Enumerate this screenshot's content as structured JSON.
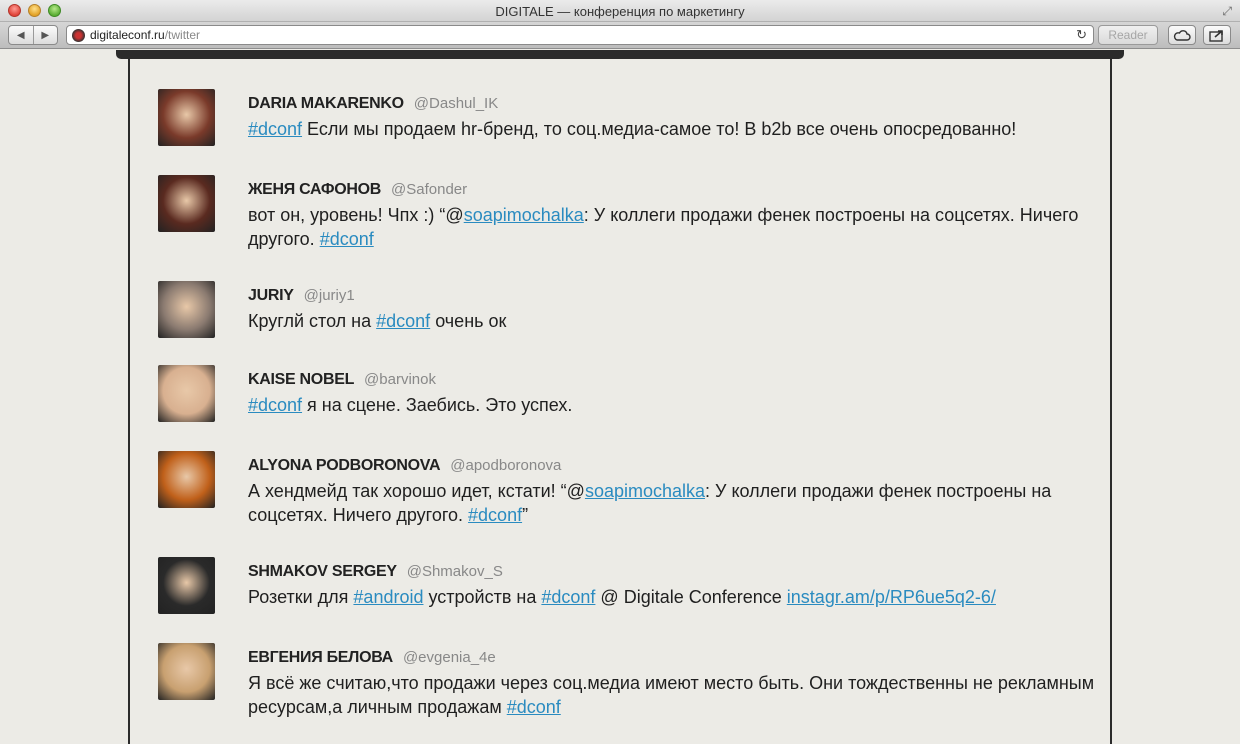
{
  "window": {
    "title": "DIGITALE — конференция по маркетингу"
  },
  "toolbar": {
    "url_domain": "digitaleconf.ru",
    "url_path": "/twitter",
    "reader_label": "Reader"
  },
  "tweets": [
    {
      "name": "DARIA MAKARENKO",
      "handle": "@Dashul_IK",
      "parts": [
        {
          "link": "#dconf"
        },
        {
          "text": " Если мы продаем hr-бренд, то соц.медиа-самое то! В b2b все очень опосредованно!"
        }
      ]
    },
    {
      "name": "ЖЕНЯ САФОНОВ",
      "handle": "@Safonder",
      "parts": [
        {
          "text": "вот он, уровень! Чпх :) “@"
        },
        {
          "link": "soapimochalka"
        },
        {
          "text": ": У коллеги продажи фенек построены на соцсетях. Ничего другого. "
        },
        {
          "link": "#dconf"
        }
      ]
    },
    {
      "name": "JURIY",
      "handle": "@juriy1",
      "parts": [
        {
          "text": "Круглй стол на "
        },
        {
          "link": "#dconf"
        },
        {
          "text": " очень ок"
        }
      ]
    },
    {
      "name": "KAISE NOBEL",
      "handle": "@barvinok",
      "parts": [
        {
          "link": "#dconf"
        },
        {
          "text": " я на сцене. Заебись. Это успех."
        }
      ]
    },
    {
      "name": "ALYONA PODBORONOVA",
      "handle": "@apodboronova",
      "parts": [
        {
          "text": "А хендмейд так хорошо идет, кстати! “@"
        },
        {
          "link": "soapimochalka"
        },
        {
          "text": ": У коллеги продажи фенек построены на соцсетях. Ничего другого. "
        },
        {
          "link": "#dconf"
        },
        {
          "text": "”"
        }
      ]
    },
    {
      "name": "SHMAKOV SERGEY",
      "handle": "@Shmakov_S",
      "parts": [
        {
          "text": "Розетки для "
        },
        {
          "link": "#android"
        },
        {
          "text": " устройств на "
        },
        {
          "link": "#dconf"
        },
        {
          "text": " @ Digitale Conference "
        },
        {
          "link": "instagr.am/p/RP6ue5q2-6/"
        }
      ]
    },
    {
      "name": "ЕВГЕНИЯ БЕЛОВА",
      "handle": "@evgenia_4e",
      "parts": [
        {
          "text": "Я всё же считаю,что продажи через соц.медиа имеют место быть. Они тождественны не рекламным ресурсам,а личным продажам "
        },
        {
          "link": "#dconf"
        }
      ]
    }
  ],
  "avatar_colors": [
    "#7a3a2a",
    "#5a2a20",
    "#8a7a70",
    "#d8b090",
    "#c0601a",
    "#2a2a2a",
    "#c8a070"
  ]
}
